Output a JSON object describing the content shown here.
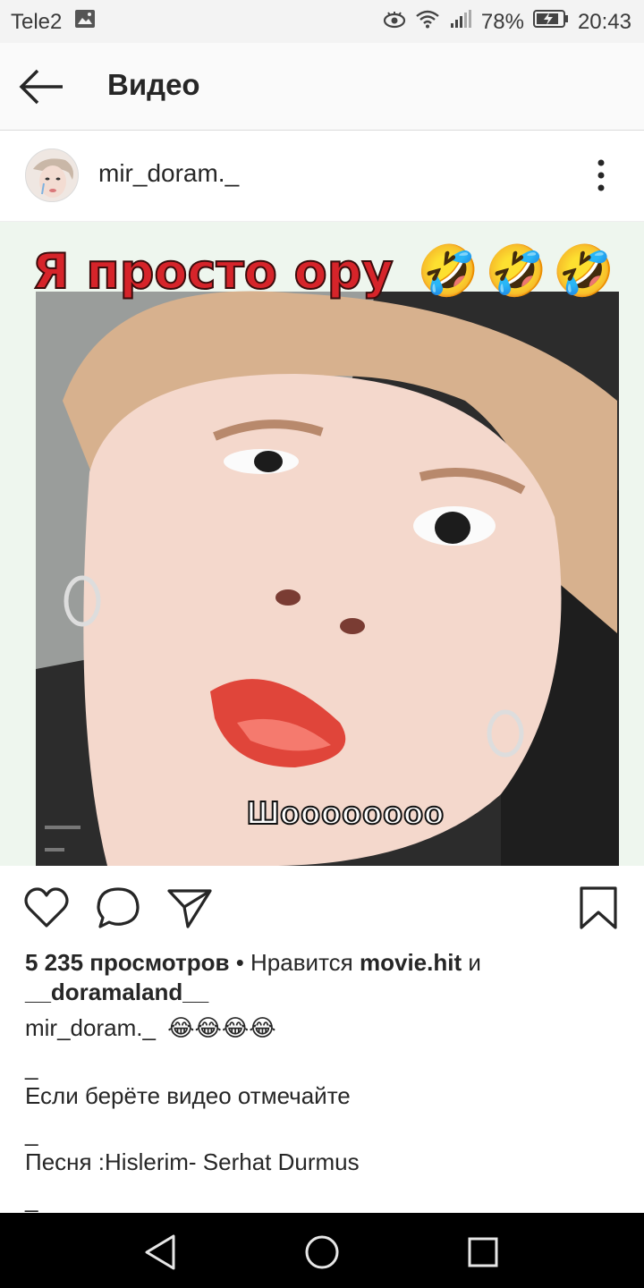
{
  "status_bar": {
    "carrier": "Tele2",
    "battery": "78%",
    "time": "20:43"
  },
  "app_bar": {
    "title": "Видео",
    "back_icon": "arrow-left-icon"
  },
  "post": {
    "username": "mir_doram._",
    "more_icon": "vertical-dots-icon",
    "media": {
      "overlay_title": "Я просто ору",
      "overlay_emojis": "🤣🤣🤣",
      "subtitle": "Шoooooooo"
    },
    "actions": {
      "like_icon": "heart-icon",
      "comment_icon": "comment-bubble-icon",
      "share_icon": "paper-plane-icon",
      "save_icon": "bookmark-icon"
    },
    "views": "5 235 просмотров",
    "liked_by_prefix": " • Нравится ",
    "liked_by_user1": "movie.hit",
    "liked_by_and": " и",
    "liked_by_user2": "__doramaland__",
    "caption_user": "mir_doram._",
    "caption_emojis": "😂😂😂😂",
    "caption_lines": [
      "_",
      "Если берёте видео отмечайте",
      "_",
      "Песня :Hislerim- Serhat Durmus",
      "_"
    ]
  },
  "nav_bar": {
    "back_icon": "triangle-back-icon",
    "home_icon": "circle-home-icon",
    "recents_icon": "square-recents-icon"
  },
  "colors": {
    "status_bar_bg": "#f3f3f3",
    "app_bar_bg": "#fafafa",
    "overlay_title_red": "#d6242a",
    "nav_bar_bg": "#000000"
  }
}
